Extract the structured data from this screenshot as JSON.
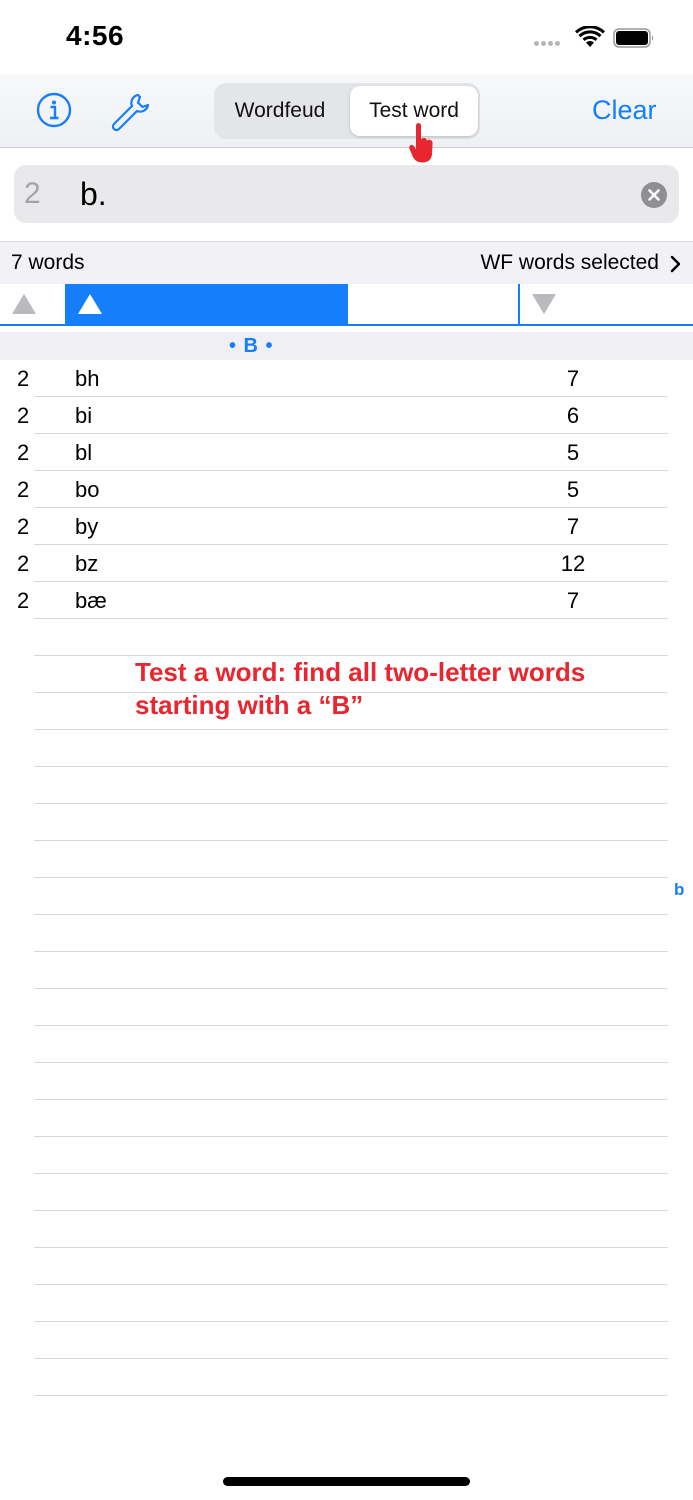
{
  "status_bar": {
    "time": "4:56"
  },
  "toolbar": {
    "segments": [
      "Wordfeud",
      "Test word"
    ],
    "selected_segment": "Test word",
    "clear_label": "Clear",
    "accent_color": "#147efb"
  },
  "search": {
    "count": "2",
    "value": "b."
  },
  "info_bar": {
    "word_count": "7 words",
    "selection": "WF words selected"
  },
  "section": {
    "label": "• B •"
  },
  "words": [
    {
      "length": "2",
      "word": "bh",
      "score": "7"
    },
    {
      "length": "2",
      "word": "bi",
      "score": "6"
    },
    {
      "length": "2",
      "word": "bl",
      "score": "5"
    },
    {
      "length": "2",
      "word": "bo",
      "score": "5"
    },
    {
      "length": "2",
      "word": "by",
      "score": "7"
    },
    {
      "length": "2",
      "word": "bz",
      "score": "12"
    },
    {
      "length": "2",
      "word": "bæ",
      "score": "7"
    }
  ],
  "index": {
    "letter": "b"
  },
  "annotation": {
    "line1": "Test a word: find all two-letter words",
    "line2": "starting with a “B”",
    "color": "#e8262f"
  }
}
